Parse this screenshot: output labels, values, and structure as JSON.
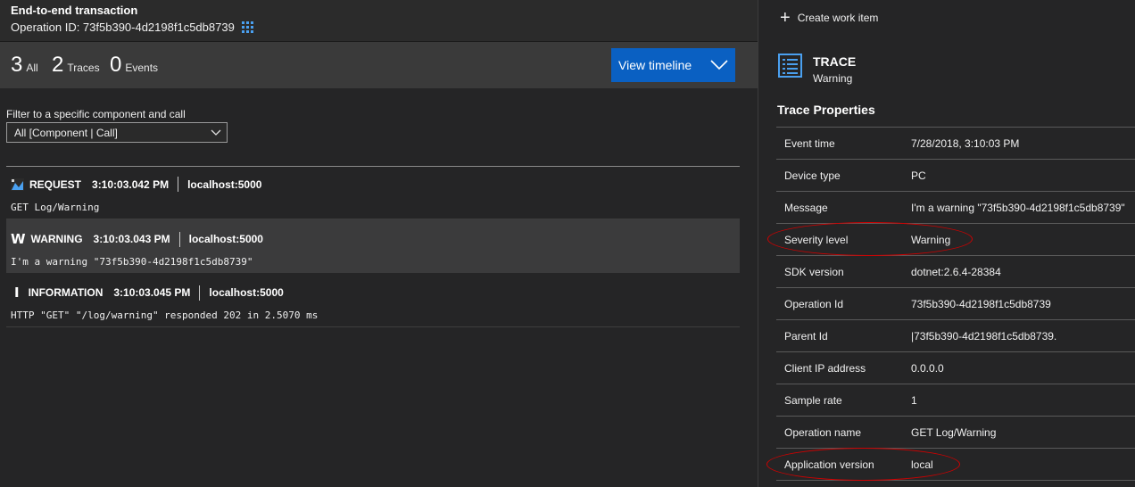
{
  "header": {
    "title": "End-to-end transaction",
    "operation_id": "Operation ID: 73f5b390-4d2198f1c5db8739"
  },
  "counts": {
    "all": {
      "n": "3",
      "label": "All"
    },
    "traces": {
      "n": "2",
      "label": "Traces"
    },
    "events": {
      "n": "0",
      "label": "Events"
    }
  },
  "view_timeline_label": "View timeline",
  "filter": {
    "label": "Filter to a specific component and call",
    "value": "All [Component | Call]"
  },
  "rows": [
    {
      "type": "REQUEST",
      "time": "3:10:03.042 PM",
      "host": "localhost:5000",
      "message": "GET Log/Warning"
    },
    {
      "icon": "W",
      "type": "WARNING",
      "time": "3:10:03.043 PM",
      "host": "localhost:5000",
      "message": "I'm a warning \"73f5b390-4d2198f1c5db8739\""
    },
    {
      "icon": "I",
      "type": "INFORMATION",
      "time": "3:10:03.045 PM",
      "host": "localhost:5000",
      "message": "HTTP \"GET\" \"/log/warning\" responded 202 in 2.5070 ms"
    }
  ],
  "right": {
    "create_work_item": "Create work item",
    "trace_title": "TRACE",
    "trace_subtitle": "Warning",
    "props_title": "Trace Properties",
    "props": [
      {
        "k": "Event time",
        "v": "7/28/2018, 3:10:03 PM"
      },
      {
        "k": "Device type",
        "v": "PC"
      },
      {
        "k": "Message",
        "v": "I'm a warning \"73f5b390-4d2198f1c5db8739\""
      },
      {
        "k": "Severity level",
        "v": "Warning"
      },
      {
        "k": "SDK version",
        "v": "dotnet:2.6.4-28384"
      },
      {
        "k": "Operation Id",
        "v": "73f5b390-4d2198f1c5db8739"
      },
      {
        "k": "Parent Id",
        "v": "|73f5b390-4d2198f1c5db8739."
      },
      {
        "k": "Client IP address",
        "v": "0.0.0.0"
      },
      {
        "k": "Sample rate",
        "v": "1"
      },
      {
        "k": "Operation name",
        "v": "GET Log/Warning"
      },
      {
        "k": "Application version",
        "v": "local"
      }
    ]
  },
  "colors": {
    "accent": "#0a60c2",
    "highlight_oval": "#d00000",
    "grid_icon": "#4aa0f0"
  },
  "icons": {
    "request": "request-icon",
    "warning": "warning-icon",
    "information": "information-icon",
    "trace": "trace-list-icon",
    "plus": "plus-icon",
    "grid": "grid-icon",
    "chevron": "chevron-down-icon"
  }
}
